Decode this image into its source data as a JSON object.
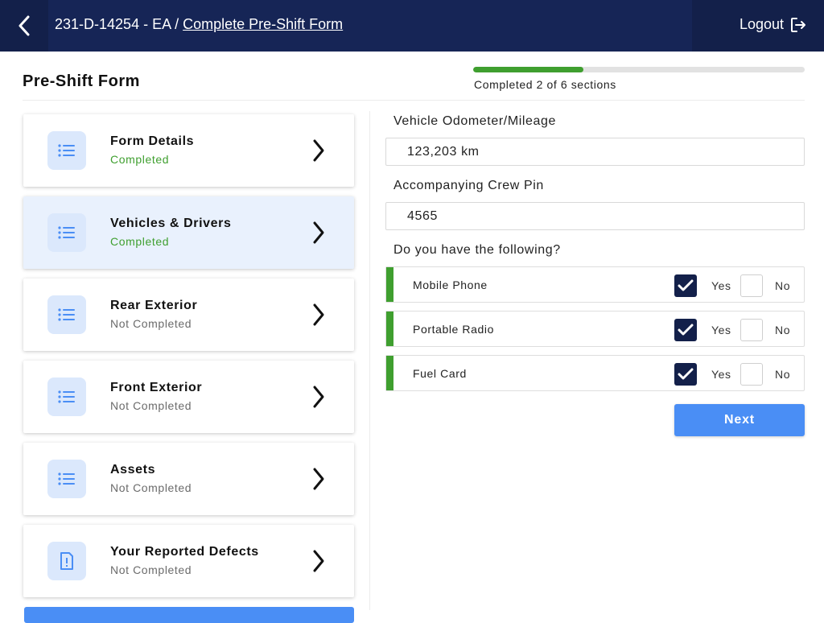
{
  "header": {
    "vehicle_id": "231-D-14254 - EA /",
    "breadcrumb_link": "Complete Pre-Shift Form",
    "logout_label": "Logout"
  },
  "page": {
    "title": "Pre-Shift Form",
    "progress_text": "Completed 2 of 6 sections",
    "progress_fraction": 0.3333
  },
  "sections": [
    {
      "name": "Form Details",
      "status": "Completed",
      "icon": "list-icon"
    },
    {
      "name": "Vehicles & Drivers",
      "status": "Completed",
      "icon": "list-icon"
    },
    {
      "name": "Rear Exterior",
      "status": "Not Completed",
      "icon": "list-icon"
    },
    {
      "name": "Front Exterior",
      "status": "Not Completed",
      "icon": "list-icon"
    },
    {
      "name": "Assets",
      "status": "Not Completed",
      "icon": "list-icon"
    },
    {
      "name": "Your Reported Defects",
      "status": "Not Completed",
      "icon": "report-icon"
    }
  ],
  "form": {
    "odometer_label": "Vehicle Odometer/Mileage",
    "odometer_value": "123,203 km",
    "crew_pin_label": "Accompanying Crew Pin",
    "crew_pin_value": "4565",
    "question": "Do you have the following?",
    "yes_label": "Yes",
    "no_label": "No",
    "items": [
      {
        "name": "Mobile Phone",
        "answer": "Yes"
      },
      {
        "name": "Portable Radio",
        "answer": "Yes"
      },
      {
        "name": "Fuel Card",
        "answer": "Yes"
      }
    ],
    "next_label": "Next"
  },
  "colors": {
    "header_bg": "#13204a",
    "accent_blue": "#4a8ef5",
    "success_green": "#3f9f2f",
    "active_card_bg": "#e9f1fd"
  }
}
